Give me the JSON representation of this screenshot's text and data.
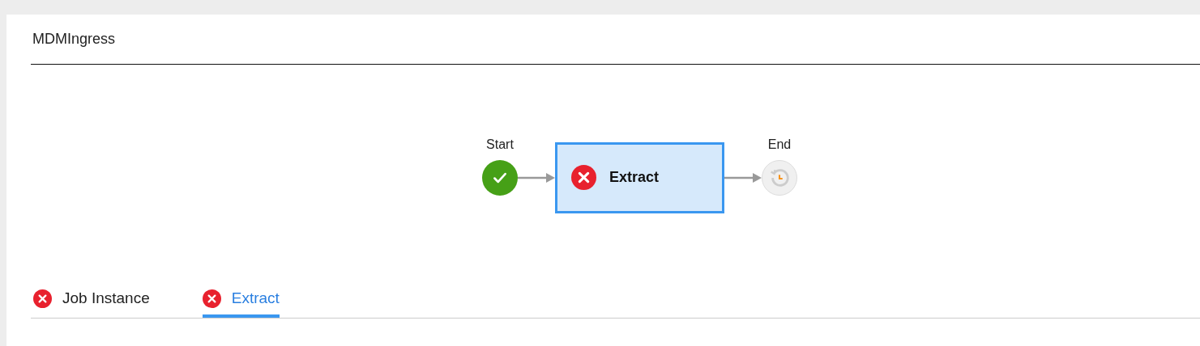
{
  "title": "MDMIngress",
  "flow": {
    "nodes": [
      {
        "kind": "start",
        "label": "Start",
        "icon": {
          "kind": "success"
        }
      },
      {
        "kind": "task",
        "label": "Extract",
        "icon": {
          "kind": "failed"
        },
        "selected": true
      },
      {
        "kind": "end",
        "label": "End",
        "icon": {
          "kind": "pending"
        }
      }
    ]
  },
  "tabs": [
    {
      "label": "Job Instance",
      "icon": {
        "kind": "failed"
      },
      "selected": false
    },
    {
      "label": "Extract",
      "icon": {
        "kind": "failed"
      },
      "selected": true
    }
  ]
}
